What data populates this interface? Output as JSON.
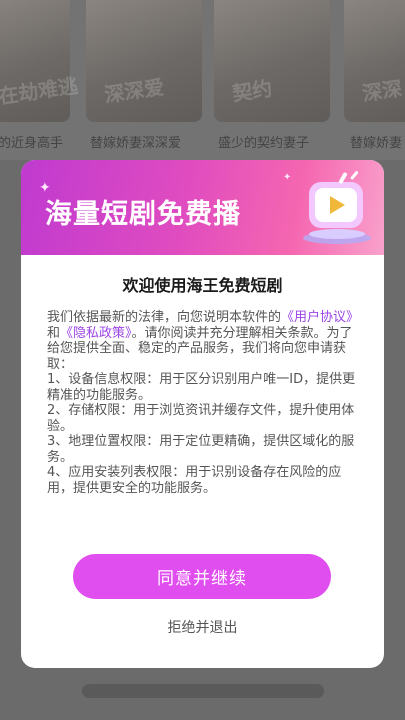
{
  "background": {
    "cards": [
      {
        "title": "的近身高手",
        "ghost": "在劫难逃"
      },
      {
        "title": "替嫁娇妻深深爱",
        "ghost": "深深爱"
      },
      {
        "title": "盛少的契约妻子",
        "ghost": "契约"
      },
      {
        "title": "替嫁娇妻",
        "ghost": "深深"
      }
    ]
  },
  "dialog": {
    "banner_text": "海量短剧免费播",
    "title": "欢迎使用海王免费短剧",
    "intro_1": "我们依据最新的法律，向您说明本软件的",
    "link_user": "《用户协议》",
    "intro_and": "和",
    "link_privacy": "《隐私政策》",
    "intro_2": "。请你阅读并充分理解相关条款。为了给您提供全面、稳定的产品服务，我们将向您申请获取：",
    "perms": [
      "1、设备信息权限：用于区分识别用户唯一ID，提供更精准的功能服务。",
      "2、存储权限：用于浏览资讯并缓存文件，提升使用体验。",
      "3、地理位置权限：用于定位更精确，提供区域化的服务。",
      "4、应用安装列表权限：用于识别设备存在风险的应用，提供更安全的功能服务。"
    ],
    "agree_label": "同意并继续",
    "refuse_label": "拒绝并退出"
  },
  "colors": {
    "accent": "#e14ef0",
    "link": "#9b45e6"
  }
}
